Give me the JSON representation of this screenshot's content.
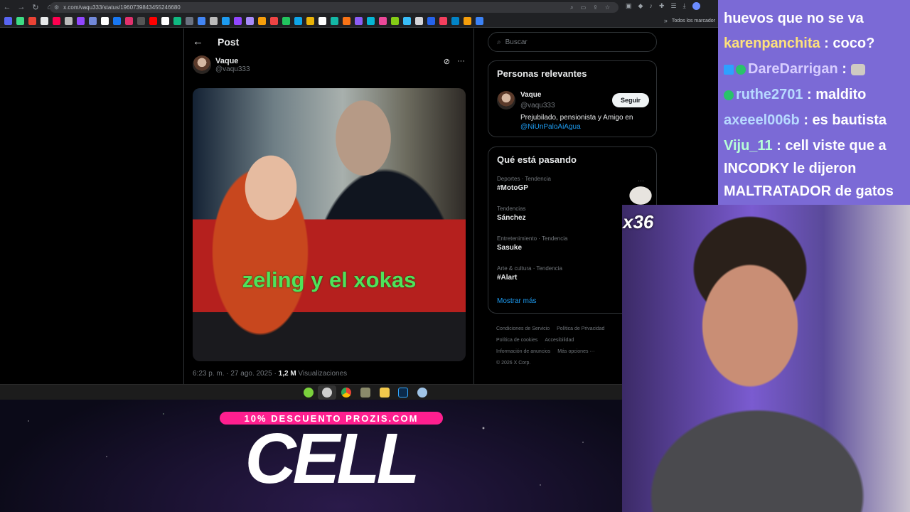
{
  "browser": {
    "url": "x.com/vaqu333/status/1960739843455246680",
    "bookmarks_folder": "Todos los marcador"
  },
  "post": {
    "header_title": "Post",
    "author_name": "Vaque",
    "author_handle": "@vaqu333",
    "image_text": "zeling y el xokas",
    "time": "6:23 p. m. · 27 ago. 2025 · ",
    "views_count": "1,2 M",
    "views_label": " Visualizaciones"
  },
  "sidebar": {
    "search_placeholder": "Buscar",
    "relevant": {
      "title": "Personas relevantes",
      "name": "Vaque",
      "handle": "@vaqu333",
      "follow_label": "Seguir",
      "bio": "Prejubilado, pensionista y Amigo en ",
      "bio_mention": "@NiUnPaloAiAgua"
    },
    "trends": {
      "title": "Qué está pasando",
      "items": [
        {
          "category": "Deportes · Tendencia",
          "name": "#MotoGP"
        },
        {
          "category": "Tendencias",
          "name": "Sánchez"
        },
        {
          "category": "Entretenimiento · Tendencia",
          "name": "Sasuke"
        },
        {
          "category": "Arte & cultura · Tendencia",
          "name": "#Alart"
        }
      ],
      "more_icon": "···",
      "show_more": "Mostrar más"
    },
    "footer": {
      "terms": "Condiciones de Servicio",
      "privacy": "Política de Privacidad",
      "cookies": "Política de cookies",
      "accessibility": "Accesibilidad",
      "ads": "Información de anuncios",
      "more": "Más opciones ···",
      "copyright": "© 2026 X Corp."
    }
  },
  "stream": {
    "promo": "10% DESCUENTO PROZIS.COM",
    "brand": "CELL",
    "sticker_count": "x36",
    "chat": [
      {
        "user": "",
        "text": "huevos que no se va",
        "cls": ""
      },
      {
        "user": "karenpanchita",
        "text": " : coco?",
        "cls": ""
      },
      {
        "user": "DareDarrigan",
        "text": " : ",
        "cls": "lav"
      },
      {
        "user": "ruthe2701",
        "text": " : maldito",
        "cls": "blue"
      },
      {
        "user": "axeeel006b",
        "text": " : es bautista",
        "cls": "blue"
      },
      {
        "user": "Viju_11",
        "text": " : cell viste que a",
        "cls": "mint"
      },
      {
        "user": "",
        "text": "INCODKY le dijeron",
        "cls": ""
      },
      {
        "user": "",
        "text": "MALTRATADOR de gatos",
        "cls": ""
      }
    ]
  },
  "colors": {
    "x_blue": "#1d9bf0",
    "promo_pink": "#ff1f8f",
    "overlay_green": "#4ee35a"
  }
}
